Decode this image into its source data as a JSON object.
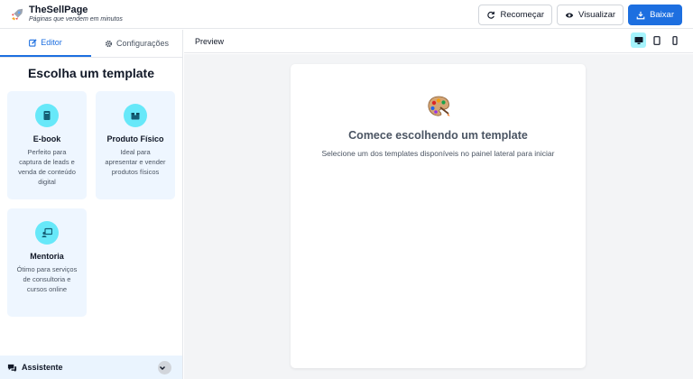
{
  "app": {
    "name": "TheSellPage",
    "tagline": "Páginas que vendem em minutos",
    "icon": "rocket-icon"
  },
  "header_actions": {
    "restart_label": "Recomeçar",
    "preview_label": "Visualizar",
    "download_label": "Baixar",
    "primary_color": "#1d6fe0"
  },
  "sidebar": {
    "tabs": [
      {
        "label": "Editor",
        "icon": "edit-icon",
        "active": true
      },
      {
        "label": "Configurações",
        "icon": "gear-icon",
        "active": false
      }
    ],
    "title": "Escolha um template",
    "templates": [
      {
        "title": "E-book",
        "description": "Perfeito para captura de leads e venda de conteúdo digital",
        "icon": "book-icon"
      },
      {
        "title": "Produto Físico",
        "description": "Ideal para apresentar e vender produtos físicos",
        "icon": "box-icon"
      },
      {
        "title": "Mentoria",
        "description": "Ótimo para serviços de consultoria e cursos online",
        "icon": "chalkboard-teacher-icon"
      }
    ],
    "assistant_label": "Assistente"
  },
  "preview": {
    "label": "Preview",
    "devices": [
      {
        "name": "desktop",
        "active": true
      },
      {
        "name": "tablet",
        "active": false
      },
      {
        "name": "mobile",
        "active": false
      }
    ],
    "empty_title": "Comece escolhendo um template",
    "empty_subtitle": "Selecione um dos templates disponíveis no painel lateral para iniciar"
  }
}
